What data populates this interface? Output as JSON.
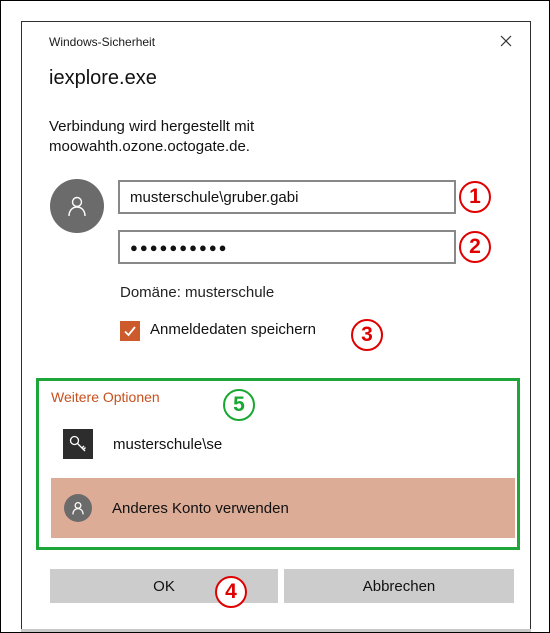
{
  "dialog": {
    "window_title": "Windows-Sicherheit",
    "app_name": "iexplore.exe",
    "message_line1": "Verbindung wird hergestellt mit",
    "message_line2": "moowahth.ozone.octogate.de.",
    "close_icon": "close-icon"
  },
  "credentials": {
    "username": "musterschule\\gruber.gabi",
    "password_mask": "●●●●●●●●●●",
    "domain_label": "Domäne: musterschule",
    "remember_label": "Anmeldedaten speichern",
    "remember_checked": true
  },
  "options": {
    "header": "Weitere Optionen",
    "items": [
      {
        "label": "musterschule\\se",
        "icon": "key-icon"
      },
      {
        "label": "Anderes Konto verwenden",
        "icon": "user-icon",
        "highlighted": true
      }
    ]
  },
  "buttons": {
    "ok": "OK",
    "cancel": "Abbrechen"
  },
  "annotations": [
    "1",
    "2",
    "3",
    "4",
    "5"
  ],
  "colors": {
    "accent": "#cc5a2b",
    "annotation_red": "#e00000",
    "annotation_green": "#1fa63a",
    "highlight_row": "#dcac97",
    "button_bg": "#cccccc"
  }
}
